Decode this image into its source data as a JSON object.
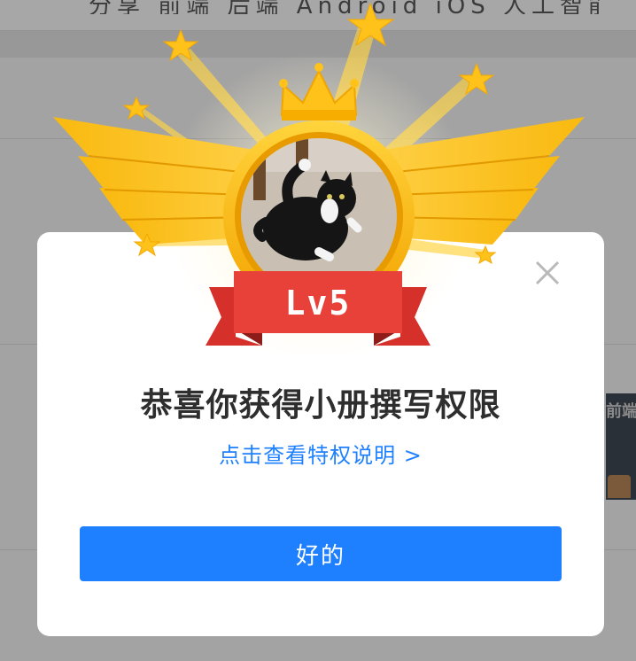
{
  "background": {
    "topbar_text": "分享 前端 后端 Android iOS 人工智能",
    "thumbnail_text": "前端"
  },
  "modal": {
    "badge_level": "Lv5",
    "title": "恭喜你获得小册撰写权限",
    "privilege_link": "点击查看特权说明 >",
    "ok_button_label": "好的",
    "close_icon": "close-icon"
  },
  "colors": {
    "accent": "#1e80ff",
    "gold": "#f7b500",
    "ribbon_red": "#e8413a"
  }
}
